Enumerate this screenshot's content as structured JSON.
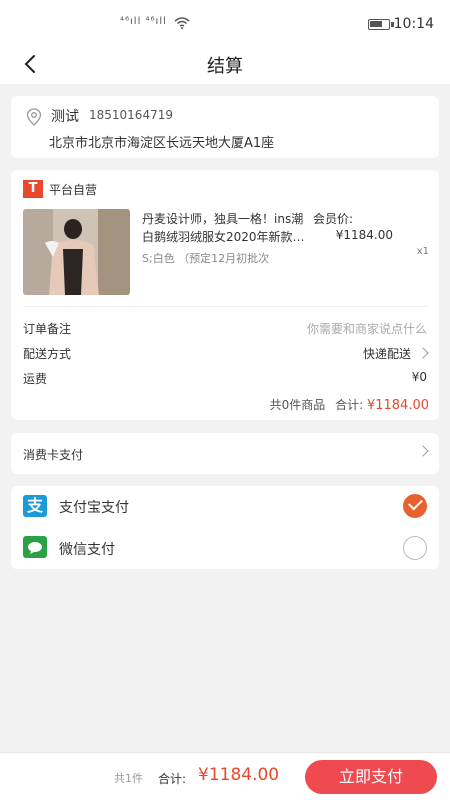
{
  "status_bar": {
    "signal_text": "⁴⁶ıll ⁴⁶ıll",
    "time": "10:14"
  },
  "nav": {
    "title": "结算",
    "back_icon": "chevron-left-icon"
  },
  "address": {
    "name": "测试",
    "phone": "18510164719",
    "detail": "北京市北京市海淀区长远天地大厦A1座",
    "icon": "location-pin-icon"
  },
  "order": {
    "shop_logo": "T",
    "shop_name": "平台自营",
    "product": {
      "title_line1": "丹麦设计师，独具一格！ins潮",
      "member_price_label": "会员价:",
      "title_line2": "白鹅绒羽绒服女2020年新款…",
      "price": "¥1184.00",
      "qty": "x1",
      "spec": "S;白色 （预定12月初批次"
    },
    "remark_label": "订单备注",
    "remark_placeholder": "你需要和商家说点什么",
    "delivery_label": "配送方式",
    "delivery_value": "快递配送",
    "freight_label": "运费",
    "freight_value": "¥0",
    "summary_count": "共0件商品",
    "summary_total_label": "合计:",
    "summary_total": "¥1184.00"
  },
  "consumer_card": {
    "label": "消费卡支付"
  },
  "payment": {
    "options": [
      {
        "label": "支付宝支付",
        "icon": "alipay-icon",
        "selected": true
      },
      {
        "label": "微信支付",
        "icon": "wechat-pay-icon",
        "selected": false
      }
    ],
    "alipay_glyph": "支"
  },
  "bottom_bar": {
    "count": "共1件",
    "total_label": "合计:",
    "total_amount": "¥1184.00",
    "pay_button": "立即支付"
  },
  "colors": {
    "accent": "#e8492d",
    "pay_button": "#ef4a4f",
    "alipay": "#1a9bd7",
    "wechat": "#2ba145"
  }
}
